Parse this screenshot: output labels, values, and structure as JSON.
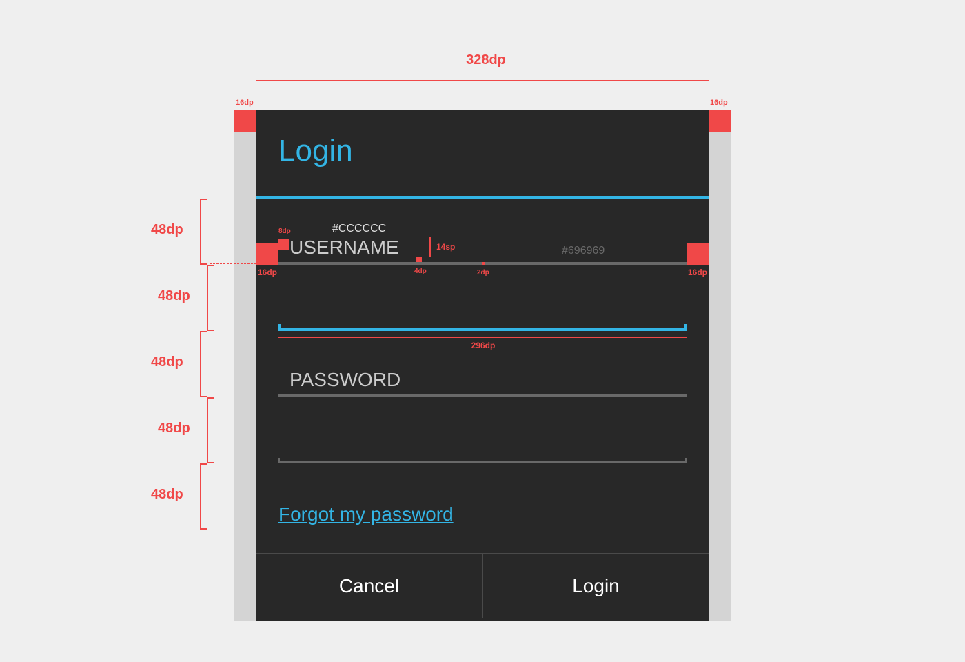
{
  "annotations": {
    "dialog_width": "328dp",
    "padding_top_left": "16dp",
    "padding_top_right": "16dp",
    "padding_field_left": "16dp",
    "padding_field_right": "16dp",
    "label_offset": "8dp",
    "text_color_hex": "#CCCCCC",
    "text_size": "14sp",
    "underline_color_hex": "#696969",
    "gap_4dp": "4dp",
    "line_2dp": "2dp",
    "field_width": "296dp",
    "row_heights": [
      "48dp",
      "48dp",
      "48dp",
      "48dp",
      "48dp"
    ]
  },
  "dialog": {
    "title": "Login",
    "username_placeholder": "USERNAME",
    "password_placeholder": "PASSWORD",
    "forgot_link": "Forgot my password",
    "cancel_label": "Cancel",
    "login_label": "Login"
  },
  "colors": {
    "accent": "#33b5e5",
    "annotation": "#f04848",
    "dialog_bg": "#282828",
    "text": "#CCCCCC",
    "underline": "#696969"
  }
}
